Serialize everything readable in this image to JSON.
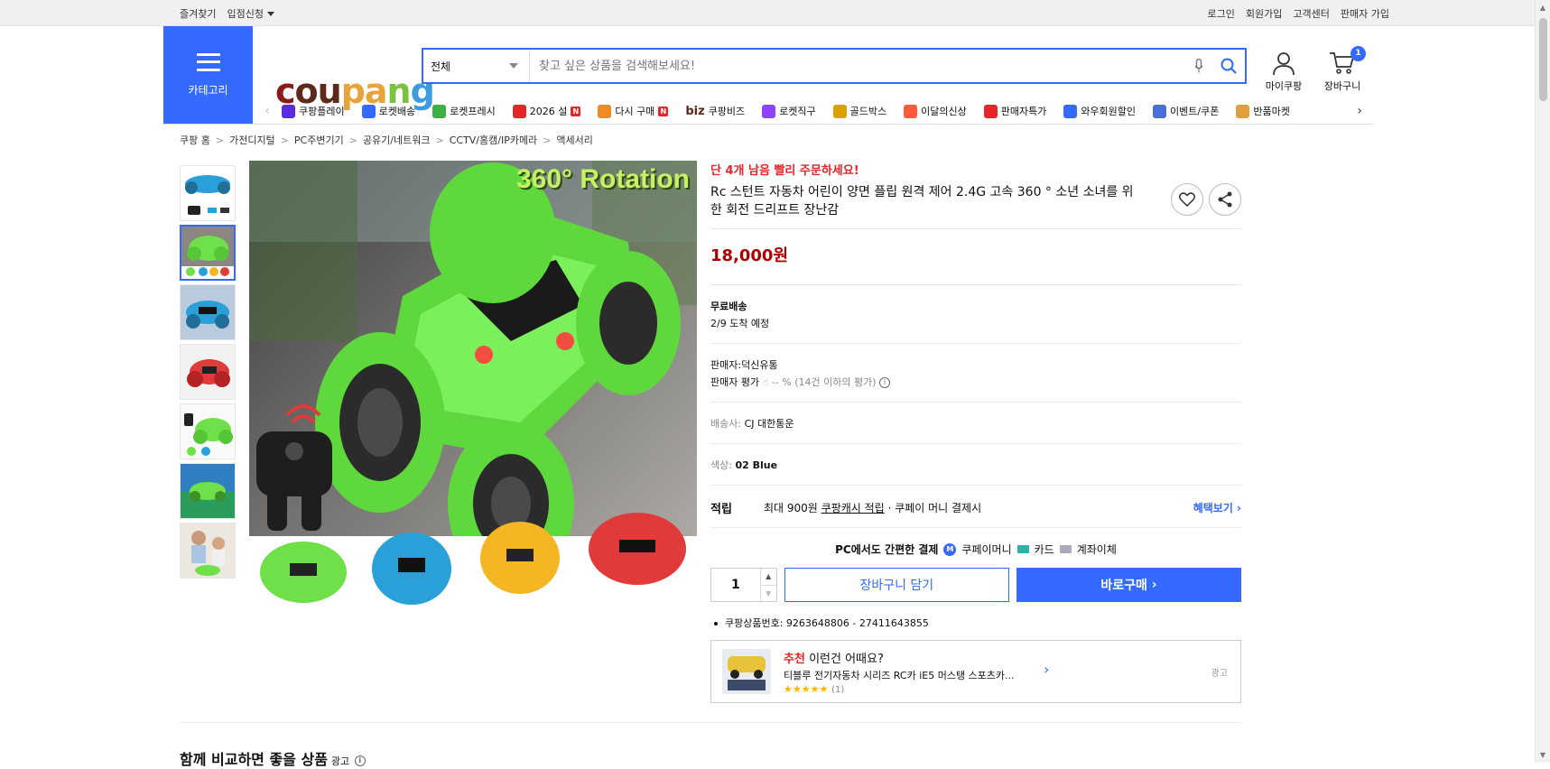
{
  "topbar": {
    "left": [
      "즐겨찾기",
      "입점신청"
    ],
    "right": [
      "로그인",
      "회원가입",
      "고객센터",
      "판매자 가입"
    ]
  },
  "header": {
    "category_label": "카테고리",
    "logo": [
      "c",
      "ou",
      "pa",
      "n",
      "g"
    ],
    "search": {
      "category": "전체",
      "placeholder": "찾고 싶은 상품을 검색해보세요!"
    },
    "mycoupang_label": "마이쿠팡",
    "cart_label": "장바구니",
    "cart_count": "1"
  },
  "nav": {
    "items": [
      {
        "label": "쿠팡플레이",
        "icon": "play-icon",
        "color": "#5b2be0"
      },
      {
        "label": "로켓배송",
        "icon": "rocket-icon",
        "color": "#346aff"
      },
      {
        "label": "로켓프레시",
        "icon": "rocket-fresh-icon",
        "color": "#3cb043"
      },
      {
        "label": "2026 설",
        "icon": "gift-icon",
        "color": "#e52528",
        "badge": "N"
      },
      {
        "label": "다시 구매",
        "icon": "rebuy-icon",
        "color": "#f08a24",
        "badge": "N"
      },
      {
        "label": "쿠팡비즈",
        "icon": "biz-icon",
        "color": "#5a2a1a",
        "prefix": "biz"
      },
      {
        "label": "로켓직구",
        "icon": "global-icon",
        "color": "#8e44ff"
      },
      {
        "label": "골드박스",
        "icon": "goldbox-icon",
        "color": "#d8a200"
      },
      {
        "label": "이달의신상",
        "icon": "new-icon",
        "color": "#ff5a3c"
      },
      {
        "label": "판매자특가",
        "icon": "percent-icon",
        "color": "#e52528"
      },
      {
        "label": "와우회원할인",
        "icon": "wow-icon",
        "color": "#346aff"
      },
      {
        "label": "이벤트/쿠폰",
        "icon": "coupon-icon",
        "color": "#4a6fd8"
      },
      {
        "label": "반품마켓",
        "icon": "market-icon",
        "color": "#e0a040"
      }
    ]
  },
  "breadcrumb": [
    "쿠팡 홈",
    "가전디지털",
    "PC주변기기",
    "공유기/네트워크",
    "CCTV/홈캠/IP카메라",
    "액세서리"
  ],
  "product": {
    "urgency": "단 4개 남음 빨리 주문하세요!",
    "title": "Rc 스턴트 자동차 어린이 양면 플립 원격 제어 2.4G 고속 360 ° 소년 소녀를 위한 회전 드리프트 장난감",
    "price": "18,000원",
    "image_caption": "360° Rotation",
    "shipping": {
      "type": "무료배송",
      "eta": "2/9 도착 예정"
    },
    "seller": {
      "label": "판매자:",
      "name": "덕신유통",
      "rating_label": "판매자 평가",
      "rating_value": "-- %",
      "rating_note": "(14건 이하의 평가)"
    },
    "courier": {
      "label": "배송사:",
      "name": "CJ 대한통운"
    },
    "option": {
      "label": "색상:",
      "value": "02 Blue"
    },
    "reward": {
      "label": "적립",
      "text1": "최대 900원",
      "link": "쿠팡캐시 적립",
      "text2": "· 쿠페이 머니 결제시",
      "benefit": "혜택보기"
    },
    "pay": {
      "label": "PC에서도 간편한 결제",
      "coupay": "쿠페이머니",
      "card": "카드",
      "bank": "계좌이체",
      "coupay_mark": "M"
    },
    "quantity": "1",
    "add_to_cart": "장바구니 담기",
    "buy_now": "바로구매",
    "product_id": "쿠팡상품번호: 9263648806 - 27411643855"
  },
  "recommend": {
    "prefix": "추천",
    "headline": "이런건 어때요?",
    "name": "티블루 전기자동차 시리즈 RC카 iE5 머스탱 스포츠카...",
    "stars": "★★★★★",
    "count": "(1)",
    "ad": "광고"
  },
  "compare": {
    "title": "함께 비교하면 좋을 상품",
    "ad": "광고"
  },
  "colors": {
    "accent": "#346aff",
    "price": "#ae0000",
    "urgent": "#e52528"
  }
}
